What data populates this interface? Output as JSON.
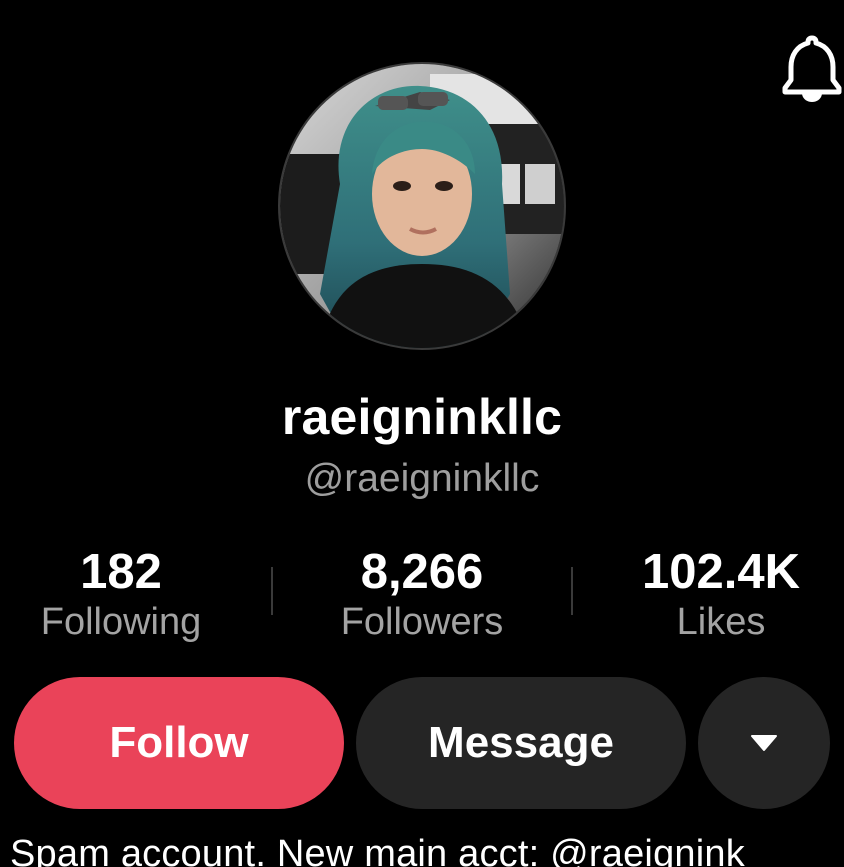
{
  "header": {
    "notification_icon": "bell-icon"
  },
  "profile": {
    "avatar_icon": "avatar",
    "display_name": "raeigninkllc",
    "handle": "@raeigninkllc"
  },
  "stats": {
    "following": {
      "value": "182",
      "label": "Following"
    },
    "followers": {
      "value": "8,266",
      "label": "Followers"
    },
    "likes": {
      "value": "102.4K",
      "label": "Likes"
    }
  },
  "actions": {
    "follow_label": "Follow",
    "message_label": "Message",
    "more_icon": "caret-down-icon"
  },
  "bio": {
    "text": "Spam account. New main acct: @raeignink"
  },
  "colors": {
    "background": "#000000",
    "follow_button": "#EA4359",
    "secondary_button": "#252525",
    "muted_text": "#9e9e9e"
  }
}
